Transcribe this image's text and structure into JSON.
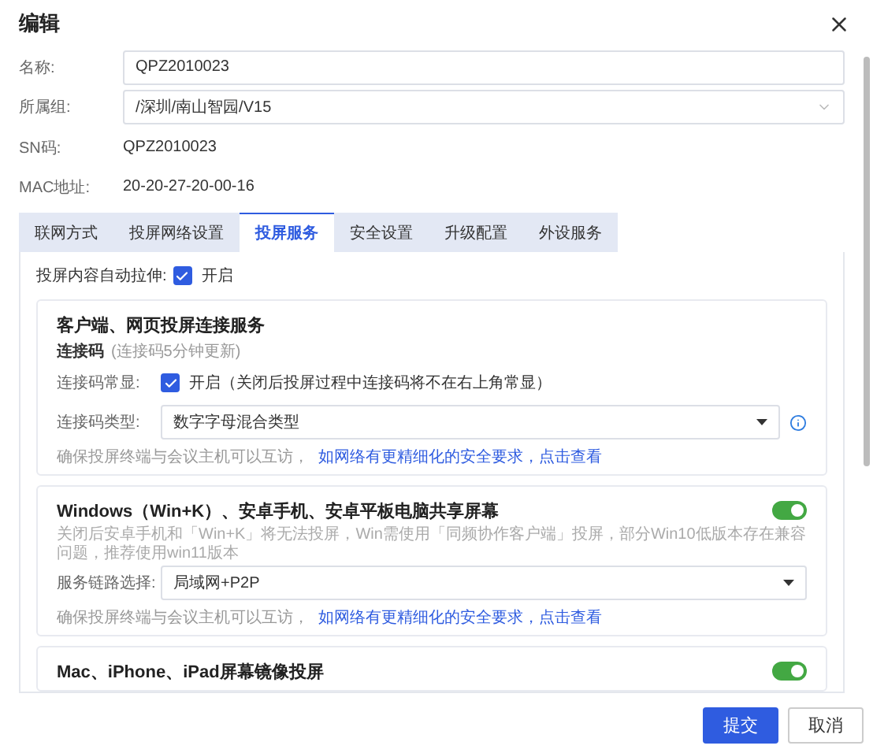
{
  "window": {
    "title": "编辑"
  },
  "fields": [
    {
      "label": "名称:",
      "kind": "input",
      "value": "QPZ2010023"
    },
    {
      "label": "所属组:",
      "kind": "select",
      "value": "/深圳/南山智园/V15"
    },
    {
      "label": "SN码:",
      "kind": "text",
      "value": "QPZ2010023"
    },
    {
      "label": "MAC地址:",
      "kind": "text",
      "value": "20-20-27-20-00-16"
    }
  ],
  "tabs": [
    {
      "label": "联网方式",
      "selected": false
    },
    {
      "label": "投屏网络设置",
      "selected": false
    },
    {
      "label": "投屏服务",
      "selected": true
    },
    {
      "label": "安全设置",
      "selected": false
    },
    {
      "label": "升级配置",
      "selected": false
    },
    {
      "label": "外设服务",
      "selected": false
    }
  ],
  "auto_stretch": {
    "label": "投屏内容自动拉伸:",
    "checked": true,
    "option": "开启"
  },
  "sections": [
    {
      "kind": "connect",
      "title": "客户端、网页投屏连接服务",
      "subtitle": "连接码",
      "subtitle_note": "(连接码5分钟更新)",
      "always_show": {
        "label": "连接码常显:",
        "checked": true,
        "option": "开启（关闭后投屏过程中连接码将不在右上角常显）"
      },
      "code_type": {
        "label": "连接码类型:",
        "value": "数字字母混合类型"
      },
      "note": "确保投屏终端与会议主机可以互访，",
      "link": "如网络有更精细化的安全要求，点击查看"
    },
    {
      "kind": "toggle",
      "title": "Windows（Win+K）、安卓手机、安卓平板电脑共享屏幕",
      "on": true,
      "description": "关闭后安卓手机和「Win+K」将无法投屏，Win需使用「同频协作客户端」投屏，部分Win10低版本存在兼容问题，推荐使用win11版本",
      "route": {
        "label": "服务链路选择:",
        "value": "局域网+P2P"
      },
      "note": "确保投屏终端与会议主机可以互访，",
      "link": "如网络有更精细化的安全要求，点击查看"
    },
    {
      "kind": "toggle",
      "title": "Mac、iPhone、iPad屏幕镜像投屏",
      "on": true
    }
  ],
  "buttons": [
    {
      "label": "提交",
      "kind": "primary"
    },
    {
      "label": "取消",
      "kind": "default"
    }
  ]
}
